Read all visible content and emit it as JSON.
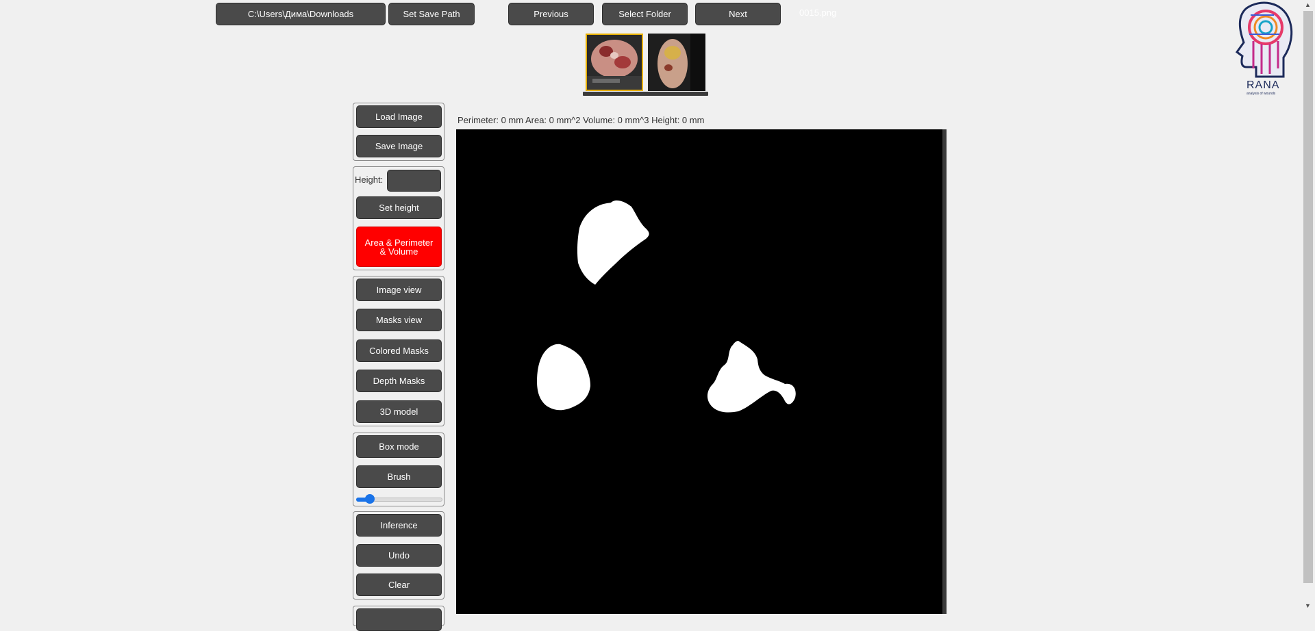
{
  "top_bar": {
    "download_path": "C:\\Users\\Дима\\Downloads",
    "set_save_path": "Set Save Path",
    "previous": "Previous",
    "select_folder": "Select Folder",
    "next": "Next",
    "filename": "0015.png"
  },
  "sidebar": {
    "load_image": "Load Image",
    "save_image": "Save Image",
    "height_label": "Height:",
    "set_height": "Set height",
    "area_perimeter_volume": "Area & Perimeter & Volume",
    "image_view": "Image view",
    "masks_view": "Masks view",
    "colored_masks": "Colored Masks",
    "depth_masks": "Depth Masks",
    "model_3d": "3D model",
    "box_mode": "Box mode",
    "brush": "Brush",
    "brush_size_fraction": 0.1,
    "inference": "Inference",
    "undo": "Undo",
    "clear": "Clear"
  },
  "stats_text": "Perimeter: 0 mm Area: 0 mm^2 Volume: 0 mm^3 Height: 0 mm",
  "logo": {
    "name": "RANA",
    "subtitle": "analysis of wounds"
  },
  "colors": {
    "button_bg": "#4a4a4a",
    "active_button_bg": "#ff0000",
    "canvas_bg": "#000000",
    "mask_fill": "#ffffff",
    "selected_thumb_border": "#e8b000",
    "slider_accent": "#1a73e8"
  }
}
